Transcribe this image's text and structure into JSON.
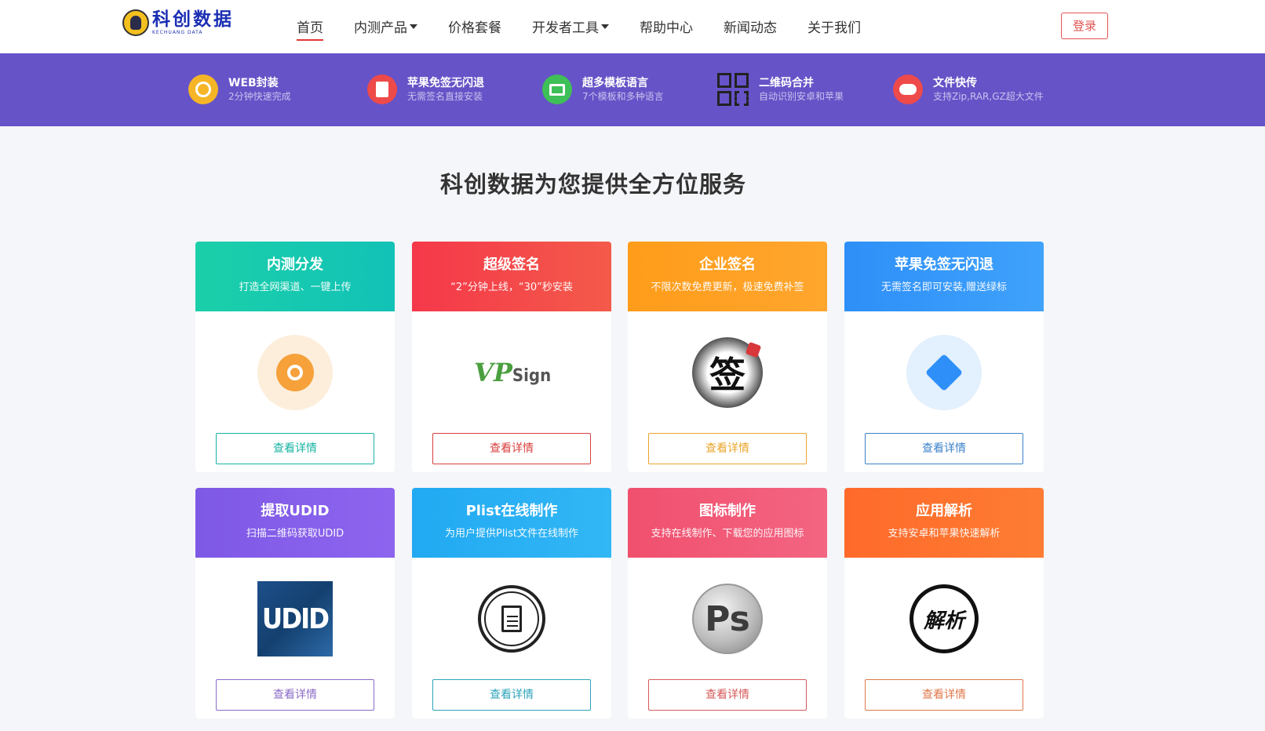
{
  "header": {
    "logo_title": "科创数据",
    "logo_sub": "KECHUANG DATA",
    "nav": [
      {
        "label": "首页"
      },
      {
        "label": "内测产品"
      },
      {
        "label": "价格套餐"
      },
      {
        "label": "开发者工具"
      },
      {
        "label": "帮助中心"
      },
      {
        "label": "新闻动态"
      },
      {
        "label": "关于我们"
      }
    ],
    "login": "登录"
  },
  "features": [
    {
      "title": "WEB封装",
      "sub": "2分钟快速完成",
      "icon": "web-icon",
      "color": "#f5b527"
    },
    {
      "title": "苹果免签无闪退",
      "sub": "无需签名直接安装",
      "icon": "apple-sign-icon",
      "color": "#ee4a4a"
    },
    {
      "title": "超多模板语言",
      "sub": "7个模板和多种语言",
      "icon": "template-icon",
      "color": "#3fbf57"
    },
    {
      "title": "二维码合并",
      "sub": "自动识别安卓和苹果",
      "icon": "qrcode-icon",
      "color": "#222222"
    },
    {
      "title": "文件快传",
      "sub": "支持Zip,RAR,GZ超大文件",
      "icon": "cloud-upload-icon",
      "color": "#ee4a4a"
    }
  ],
  "section_title": "科创数据为您提供全方位服务",
  "cards": [
    {
      "title": "内测分发",
      "sub": "打造全网渠道、一键上传",
      "button": "查看详情",
      "color": "#1bcfa9",
      "color2": "#12c2b7",
      "btn_color": "#17b3a3",
      "icon": "link-icon"
    },
    {
      "title": "超级签名",
      "sub": "“2”分钟上线，“30”秒安装",
      "button": "查看详情",
      "color": "#f5384a",
      "color2": "#f45a4a",
      "btn_color": "#d9403f",
      "icon": "vpsign-logo",
      "logo_text": "VP",
      "logo_text2": "Sign"
    },
    {
      "title": "企业签名",
      "sub": "不限次数免费更新，极速免费补签",
      "button": "查看详情",
      "color": "#ff9c1a",
      "color2": "#ffa62e",
      "btn_color": "#e9a52b",
      "icon": "sign-seal-icon",
      "logo_text": "签"
    },
    {
      "title": "苹果免签无闪退",
      "sub": "无需签名即可安装,赠送绿标",
      "button": "查看详情",
      "color": "#2e8ff8",
      "color2": "#3fa2fb",
      "btn_color": "#3b82c9",
      "icon": "cube-icon"
    },
    {
      "title": "提取UDID",
      "sub": "扫描二维码获取UDID",
      "button": "查看详情",
      "color": "#7e59e6",
      "color2": "#8d64ee",
      "btn_color": "#8b6bc7",
      "icon": "udid-logo",
      "logo_text": "UDID"
    },
    {
      "title": "Plist在线制作",
      "sub": "为用户提供Plist文件在线制作",
      "button": "查看详情",
      "color": "#21a9f2",
      "color2": "#32b7f5",
      "btn_color": "#2ca4ba",
      "icon": "document-icon"
    },
    {
      "title": "图标制作",
      "sub": "支持在线制作、下载您的应用图标",
      "button": "查看详情",
      "color": "#f0506e",
      "color2": "#f36582",
      "btn_color": "#d65a5a",
      "icon": "photoshop-icon",
      "logo_text": "Ps"
    },
    {
      "title": "应用解析",
      "sub": "支持安卓和苹果快速解析",
      "button": "查看详情",
      "color": "#ff6a2a",
      "color2": "#fd7c33",
      "btn_color": "#e0774a",
      "icon": "parse-icon",
      "logo_text": "解析"
    }
  ]
}
